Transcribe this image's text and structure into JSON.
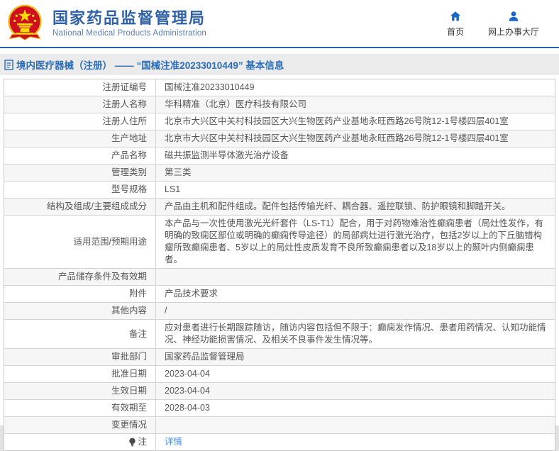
{
  "header": {
    "title": "国家药品监督管理局",
    "subtitle": "National Medical Products Administration",
    "nav_home": "首页",
    "nav_service_hall": "网上办事大厅"
  },
  "breadcrumb": {
    "title": "境内医疗器械（注册） —— “国械注准20233010449” 基本信息"
  },
  "colors": {
    "header_blue": "#2f62a8",
    "header_border": "#2b5ea9",
    "nav_icon_blue": "#1a66c9",
    "breadcrumb_bg": "#ebebeb",
    "breadcrumb_text": "#2c6cb5",
    "table_border": "#c9c9c9",
    "row_alt_bg": "#f6f6f6",
    "text_gray": "#555555",
    "link_blue": "#3f8ce0"
  },
  "table": {
    "rows": [
      {
        "label": "注册证编号",
        "value": "国械注准20233010449"
      },
      {
        "label": "注册人名称",
        "value": "华科精准（北京）医疗科技有限公司"
      },
      {
        "label": "注册人住所",
        "value": "北京市大兴区中关村科技园区大兴生物医药产业基地永旺西路26号院12-1号楼四层401室"
      },
      {
        "label": "生产地址",
        "value": "北京市大兴区中关村科技园区大兴生物医药产业基地永旺西路26号院12-1号楼四层401室"
      },
      {
        "label": "产品名称",
        "value": "磁共振监测半导体激光治疗设备"
      },
      {
        "label": "管理类别",
        "value": "第三类"
      },
      {
        "label": "型号规格",
        "value": "LS1"
      },
      {
        "label": "结构及组成/主要组成成分",
        "value": "产品由主机和配件组成。配件包括传输光纤、耦合器、遥控联锁、防护眼镜和脚踏开关。"
      },
      {
        "label": "适用范围/预期用途",
        "value": "本产品与一次性使用激光光纤套件（LS-T1）配合，用于对药物难治性癫痫患者（局灶性发作，有明确的致痫区部位或明确的癫痫传导途径）的局部病灶进行激光治疗，包括2岁以上的下丘脑错构瘤所致癫痫患者、5岁以上的局灶性皮质发育不良所致癫痫患者以及18岁以上的颞叶内侧癫痫患者。"
      },
      {
        "label": "产品储存条件及有效期",
        "value": ""
      },
      {
        "label": "附件",
        "value": "产品技术要求"
      },
      {
        "label": "其他内容",
        "value": "/"
      },
      {
        "label": "备注",
        "value": "应对患者进行长期跟踪随访，随访内容包括但不限于：癫痫发作情况、患者用药情况、认知功能情况、神经功能损害情况、及相关不良事件发生情况等。"
      },
      {
        "label": "审批部门",
        "value": "国家药品监督管理局"
      },
      {
        "label": "批准日期",
        "value": "2023-04-04"
      },
      {
        "label": "生效日期",
        "value": "2023-04-04"
      },
      {
        "label": "有效期至",
        "value": "2028-04-03"
      },
      {
        "label": "变更情况",
        "value": ""
      },
      {
        "label": "注",
        "value": "详情"
      }
    ]
  }
}
